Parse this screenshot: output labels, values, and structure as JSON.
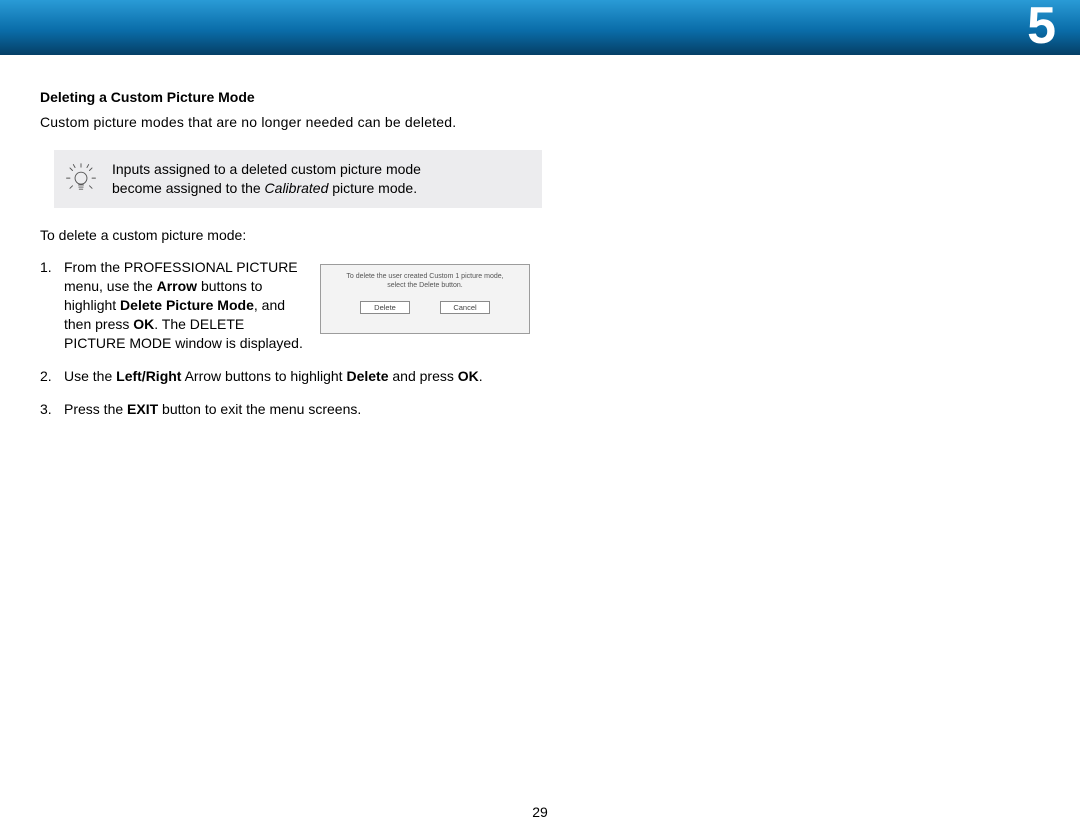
{
  "chapter": "5",
  "page_number": "29",
  "section_heading": "Deleting a Custom Picture Mode",
  "intro": "Custom picture modes that are no longer needed can be deleted.",
  "tip": {
    "line1": "Inputs assigned to a deleted custom picture mode",
    "line2_a": "become assigned to the ",
    "line2_em": "Calibrated",
    "line2_b": " picture mode."
  },
  "lead": "To delete a custom picture mode:",
  "steps": {
    "s1": {
      "a": "From the PROFESSIONAL PICTURE menu, use the ",
      "b_arrow": "Arrow",
      "c": " buttons to highlight ",
      "b_dpm": "Delete Picture Mode",
      "d": ", and then press ",
      "b_ok": "OK",
      "e": ". The DELETE PICTURE MODE window is displayed."
    },
    "s2": {
      "a": "Use the ",
      "b_lr": "Left/Right",
      "c": " Arrow buttons to highlight ",
      "b_del": "Delete",
      "d": " and press ",
      "b_ok": "OK",
      "e": "."
    },
    "s3": {
      "a": "Press the ",
      "b_exit": "EXIT",
      "c": " button to exit the menu screens."
    }
  },
  "dialog": {
    "line1": "To delete the user created Custom 1 picture mode,",
    "line2": "select the Delete button.",
    "delete_label": "Delete",
    "cancel_label": "Cancel"
  }
}
